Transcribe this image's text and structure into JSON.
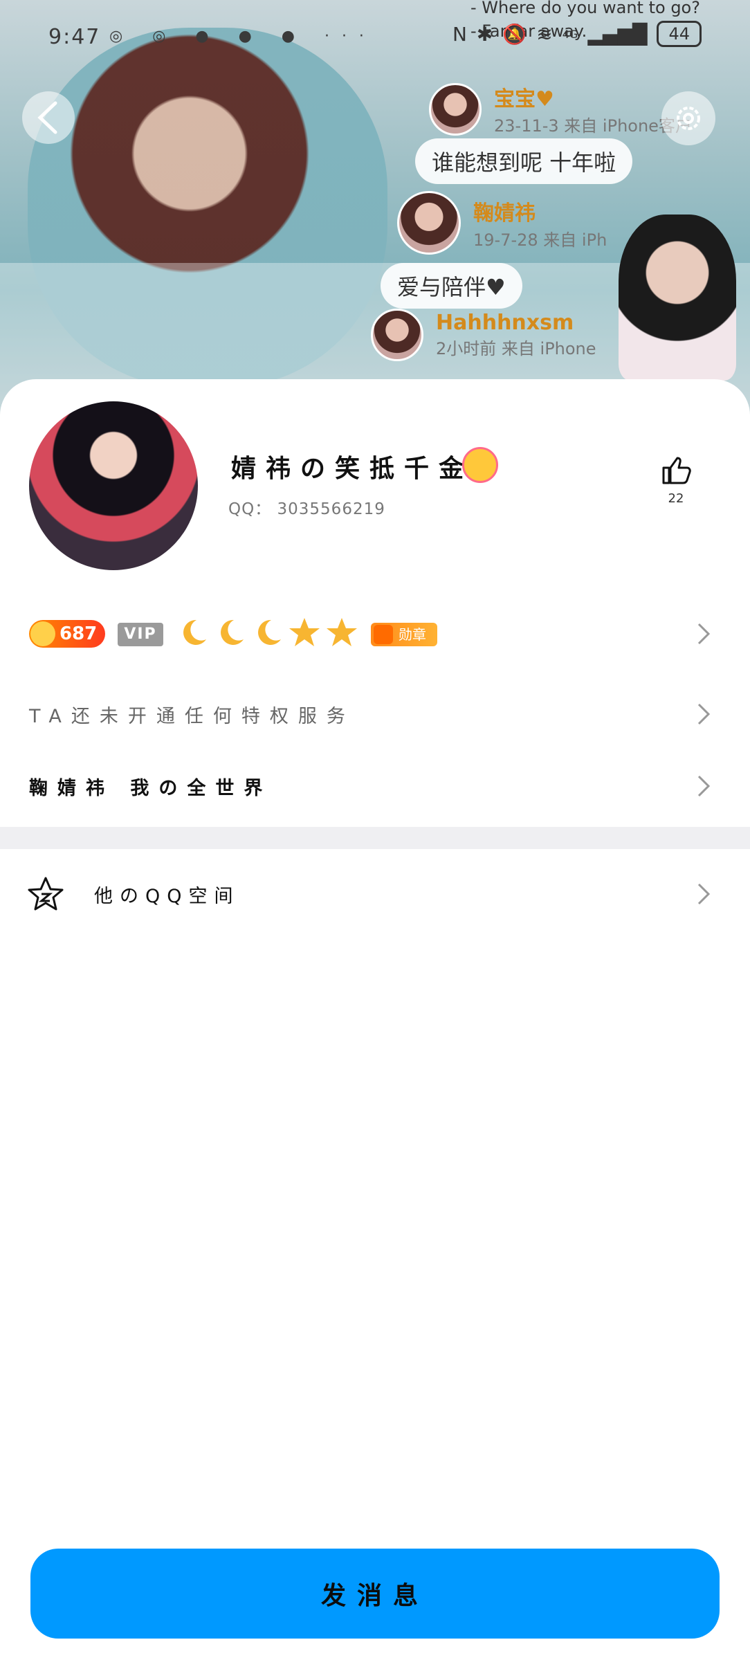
{
  "status_bar": {
    "time": "9:47",
    "notification_dots": "◎ ◎ ● ● ● ···",
    "signal_label": "4G",
    "battery": "44"
  },
  "cover": {
    "tagline_1": "- Where do you want to go?",
    "tagline_2": "- Far far away.",
    "comments": [
      {
        "name": "宝宝♥",
        "meta": "23-11-3 来自 iPhone客户",
        "text": "谁能想到呢 十年啦"
      },
      {
        "name": "鞠婧祎",
        "meta": "19-7-28 来自 iPh",
        "text": "爱与陪伴♥"
      },
      {
        "name": "Hahhhnxsm",
        "meta": "2小时前 来自 iPhone",
        "text": ""
      }
    ]
  },
  "profile": {
    "nickname": "婧祎の笑抵千金",
    "qq": "QQ： 3035566219",
    "likes": "22"
  },
  "badges": {
    "coin": "687",
    "vip": "VIP",
    "medal": "勋章"
  },
  "rows": {
    "privilege": "TA还未开通任何特权服务",
    "signature": "鞠婧祎 我の全世界",
    "qzone": "他のQQ空间"
  },
  "actions": {
    "send_message": "发消息"
  },
  "colors": {
    "primary": "#0099ff",
    "coin": "#ff5a1f",
    "vip": "#9a9a9a",
    "moon": "#f7b531"
  }
}
